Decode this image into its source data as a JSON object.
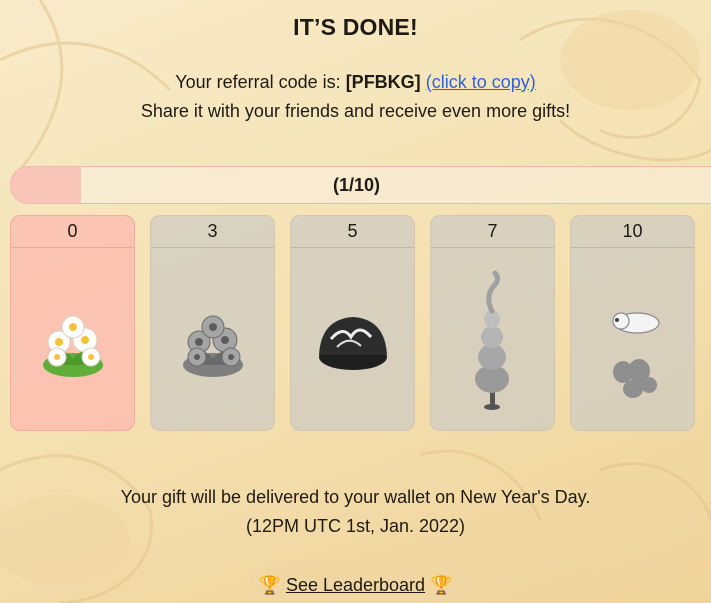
{
  "header": {
    "title": "IT’S DONE!"
  },
  "referral": {
    "prefix": "Your referral code is:",
    "code": "[PFBKG]",
    "copy_link": "(click to copy)",
    "share_text": "Share it with your friends and receive even more gifts!"
  },
  "progress": {
    "label": "(1/10)",
    "current": 1,
    "total": 10
  },
  "tiers": [
    {
      "threshold": "0",
      "reward_icon": "white-flower-bouquet-icon",
      "unlocked": true
    },
    {
      "threshold": "3",
      "reward_icon": "grey-flower-bouquet-icon",
      "unlocked": false
    },
    {
      "threshold": "5",
      "reward_icon": "chocolate-truffle-icon",
      "unlocked": false
    },
    {
      "threshold": "7",
      "reward_icon": "swirl-tree-icon",
      "unlocked": false
    },
    {
      "threshold": "10",
      "reward_icon": "sheep-and-stones-icon",
      "unlocked": false
    }
  ],
  "footer": {
    "delivery_text": "Your gift will be delivered to your wallet on New Year's Day.",
    "delivery_date": "(12PM UTC 1st, Jan. 2022)",
    "leaderboard_link": "See Leaderboard",
    "trophy_glyph": "🏆"
  },
  "colors": {
    "background": "#f5e2b4",
    "active_tier": "#fcbcb0",
    "locked_tier": "#cdcbc4",
    "link": "#2e63d6"
  }
}
